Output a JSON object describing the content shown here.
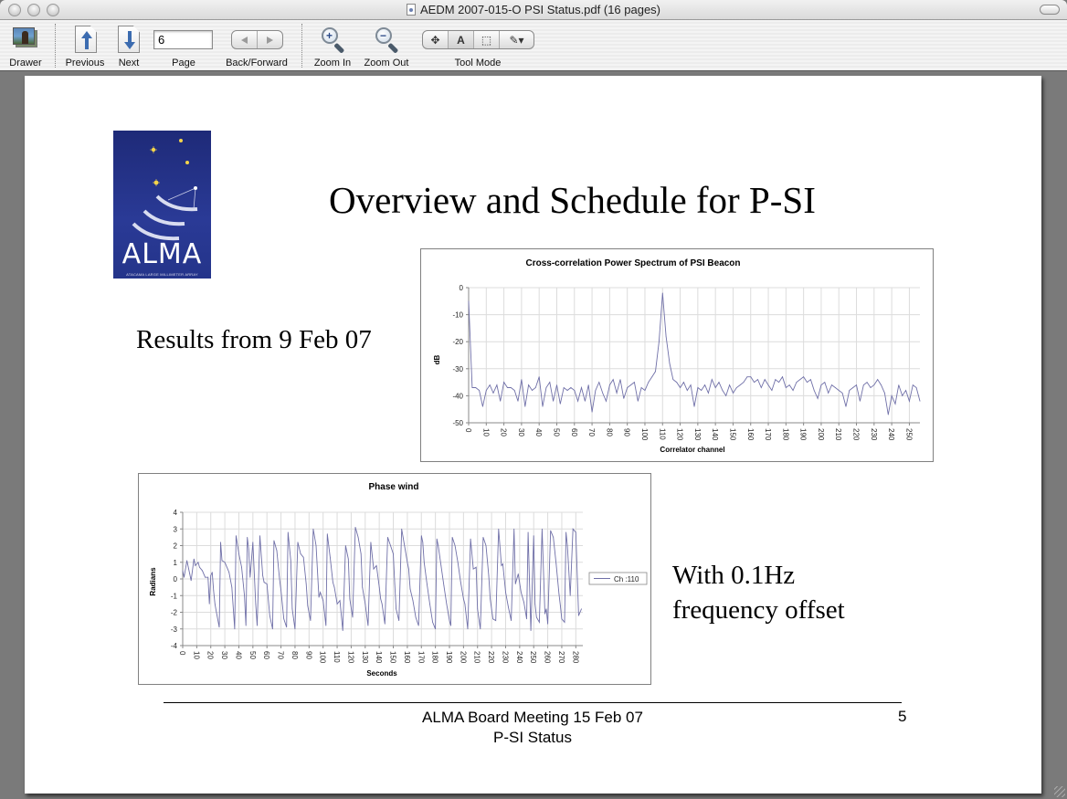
{
  "window": {
    "title": "AEDM 2007-015-O PSI Status.pdf (16 pages)",
    "file_icon": "pdf-document-icon"
  },
  "toolbar": {
    "drawer_label": "Drawer",
    "previous_label": "Previous",
    "next_label": "Next",
    "page_label": "Page",
    "page_value": "6",
    "back_forward_label": "Back/Forward",
    "zoom_in_label": "Zoom In",
    "zoom_out_label": "Zoom Out",
    "tool_mode_label": "Tool Mode",
    "tool_modes": [
      "move",
      "text",
      "select",
      "annotate"
    ],
    "tool_mode_glyphs": [
      "✥",
      "A",
      "⬚",
      "✎▾"
    ],
    "zoom_in_sign": "+",
    "zoom_out_sign": "−"
  },
  "slide": {
    "title": "Overview and Schedule for P-SI",
    "results_text": "Results from 9 Feb 07",
    "offset_line1": "With 0.1Hz",
    "offset_line2": "frequency offset",
    "logo_text": "ALMA",
    "logo_subtext": "ATACAMA LARGE MILLIMETER ARRAY",
    "footer_line1": "ALMA Board Meeting 15 Feb 07",
    "footer_line2": "P-SI Status",
    "page_number": "5"
  },
  "chart_data": [
    {
      "type": "line",
      "title": "Cross-correlation Power Spectrum of PSI Beacon",
      "xlabel": "Correlator channel",
      "ylabel": "dB",
      "xlim": [
        0,
        256
      ],
      "ylim": [
        -50,
        0
      ],
      "xticks": [
        0,
        10,
        20,
        30,
        40,
        50,
        60,
        70,
        80,
        90,
        100,
        110,
        120,
        130,
        140,
        150,
        160,
        170,
        180,
        190,
        200,
        210,
        220,
        230,
        240,
        250
      ],
      "yticks": [
        0,
        -10,
        -20,
        -30,
        -40,
        -50
      ],
      "grid": true,
      "line_color": "#7070a8",
      "x": [
        0,
        2,
        4,
        6,
        8,
        10,
        12,
        14,
        16,
        18,
        20,
        22,
        24,
        26,
        28,
        30,
        32,
        34,
        36,
        38,
        40,
        42,
        44,
        46,
        48,
        50,
        52,
        54,
        56,
        58,
        60,
        62,
        64,
        66,
        68,
        70,
        72,
        74,
        76,
        78,
        80,
        82,
        84,
        86,
        88,
        90,
        92,
        94,
        96,
        98,
        100,
        102,
        104,
        106,
        108,
        110,
        112,
        114,
        116,
        118,
        120,
        122,
        124,
        126,
        128,
        130,
        132,
        134,
        136,
        138,
        140,
        142,
        144,
        146,
        148,
        150,
        152,
        154,
        156,
        158,
        160,
        162,
        164,
        166,
        168,
        170,
        172,
        174,
        176,
        178,
        180,
        182,
        184,
        186,
        188,
        190,
        192,
        194,
        196,
        198,
        200,
        202,
        204,
        206,
        208,
        210,
        212,
        214,
        216,
        218,
        220,
        222,
        224,
        226,
        228,
        230,
        232,
        234,
        236,
        238,
        240,
        242,
        244,
        246,
        248,
        250,
        252,
        254,
        256
      ],
      "values": [
        -5,
        -37,
        -37,
        -38,
        -44,
        -38,
        -36,
        -39,
        -36,
        -42,
        -35,
        -37,
        -37,
        -38,
        -42,
        -34,
        -44,
        -36,
        -38,
        -37,
        -33,
        -44,
        -37,
        -35,
        -42,
        -36,
        -43,
        -37,
        -38,
        -37,
        -38,
        -42,
        -37,
        -42,
        -36,
        -46,
        -38,
        -35,
        -39,
        -42,
        -36,
        -34,
        -39,
        -34,
        -41,
        -37,
        -36,
        -35,
        -42,
        -37,
        -38,
        -35,
        -33,
        -31,
        -20,
        -2,
        -18,
        -28,
        -34,
        -35,
        -37,
        -35,
        -38,
        -36,
        -44,
        -37,
        -38,
        -36,
        -39,
        -34,
        -37,
        -35,
        -38,
        -40,
        -36,
        -39,
        -37,
        -36,
        -35,
        -33,
        -33,
        -35,
        -34,
        -37,
        -34,
        -36,
        -38,
        -34,
        -35,
        -33,
        -37,
        -36,
        -38,
        -35,
        -34,
        -33,
        -35,
        -34,
        -38,
        -41,
        -36,
        -35,
        -39,
        -36,
        -37,
        -38,
        -39,
        -44,
        -38,
        -37,
        -36,
        -42,
        -36,
        -35,
        -37,
        -36,
        -34,
        -36,
        -39,
        -47,
        -40,
        -43,
        -36,
        -40,
        -38,
        -42,
        -36,
        -37,
        -42
      ]
    },
    {
      "type": "line",
      "title": "Phase wind",
      "xlabel": "Seconds",
      "ylabel": "Radians",
      "xlim": [
        0,
        285
      ],
      "ylim": [
        -4,
        4
      ],
      "xticks": [
        0,
        10,
        20,
        30,
        40,
        50,
        60,
        70,
        80,
        90,
        100,
        110,
        120,
        130,
        140,
        150,
        160,
        170,
        180,
        190,
        200,
        210,
        220,
        230,
        240,
        250,
        260,
        270,
        280
      ],
      "yticks": [
        4,
        3,
        2,
        1,
        0,
        -1,
        -2,
        -3,
        -4
      ],
      "grid": true,
      "legend": [
        "Ch :110"
      ],
      "legend_position": "right",
      "line_color": "#7070a8",
      "x": [
        0,
        1,
        3,
        5,
        6,
        8,
        9,
        11,
        12,
        14,
        16,
        18,
        19,
        20,
        21,
        22,
        23,
        24,
        26,
        27,
        28,
        30,
        32,
        33,
        35,
        37,
        38,
        40,
        42,
        44,
        45,
        46,
        47,
        48,
        50,
        52,
        53,
        55,
        57,
        58,
        60,
        62,
        64,
        65,
        67,
        69,
        70,
        72,
        74,
        75,
        77,
        78,
        80,
        82,
        84,
        86,
        88,
        89,
        91,
        93,
        95,
        97,
        98,
        100,
        102,
        103,
        105,
        107,
        108,
        110,
        112,
        114,
        116,
        118,
        119,
        121,
        123,
        125,
        127,
        128,
        130,
        132,
        134,
        136,
        138,
        140,
        141,
        142,
        144,
        146,
        148,
        150,
        151,
        152,
        154,
        156,
        158,
        160,
        161,
        162,
        164,
        166,
        168,
        170,
        171,
        172,
        174,
        176,
        178,
        180,
        181,
        182,
        184,
        186,
        188,
        190,
        191,
        192,
        194,
        196,
        198,
        200,
        201,
        203,
        205,
        207,
        209,
        210,
        212,
        214,
        216,
        218,
        219,
        221,
        223,
        225,
        227,
        228,
        230,
        232,
        234,
        236,
        237,
        239,
        241,
        243,
        245,
        246,
        248,
        250,
        251,
        252,
        254,
        256,
        258,
        259,
        260,
        262,
        264,
        266,
        268,
        269,
        270,
        272,
        273,
        274,
        276,
        278,
        280,
        282,
        284
      ],
      "values": [
        0.5,
        0.1,
        1.1,
        0.3,
        -0.1,
        1.2,
        0.8,
        1.0,
        0.7,
        0.5,
        0.1,
        0.1,
        -1.5,
        0.2,
        0.4,
        -0.7,
        -1.5,
        -2.0,
        -2.9,
        2.2,
        1.1,
        1.0,
        0.6,
        0.4,
        -0.5,
        -3.0,
        2.6,
        1.5,
        0.7,
        -1.0,
        -2.8,
        2.5,
        1.8,
        0.1,
        2.2,
        -1.5,
        -2.8,
        2.6,
        0.2,
        -0.2,
        -0.3,
        -2.2,
        -3.0,
        2.3,
        1.7,
        0.0,
        -0.7,
        -2.4,
        -2.9,
        2.8,
        1.1,
        -1.8,
        -3.0,
        2.2,
        1.5,
        1.3,
        -0.3,
        -1.6,
        -2.5,
        3.0,
        2.0,
        -1.1,
        -0.8,
        -1.3,
        -2.8,
        2.7,
        1.3,
        -0.2,
        -0.5,
        -1.5,
        -1.3,
        -3.1,
        2.0,
        1.2,
        -1.2,
        -2.3,
        3.1,
        2.5,
        1.5,
        -0.5,
        -1.5,
        -2.8,
        2.2,
        0.6,
        0.8,
        -0.5,
        -1.2,
        -1.5,
        -2.7,
        2.5,
        2.0,
        1.5,
        -0.3,
        -1.8,
        -2.5,
        3.0,
        2.0,
        1.0,
        0.6,
        -0.6,
        -1.3,
        -2.3,
        -2.8,
        2.6,
        2.2,
        1.0,
        -0.3,
        -1.5,
        -2.6,
        -3.0,
        2.4,
        2.0,
        0.8,
        -0.4,
        -1.5,
        -2.5,
        -2.8,
        2.5,
        2.0,
        1.0,
        -0.2,
        -1.2,
        -1.5,
        -3.0,
        2.4,
        0.6,
        0.7,
        -1.8,
        -3.0,
        2.5,
        2.0,
        0.2,
        -1.2,
        -2.4,
        -2.5,
        3.0,
        0.8,
        0.9,
        -0.8,
        -1.7,
        -2.5,
        3.0,
        -0.3,
        0.3,
        -0.8,
        -1.4,
        -2.4,
        2.8,
        -3.1,
        2.6,
        -1.5,
        -2.3,
        -2.6,
        3.0,
        -2.1,
        -1.8,
        -2.7,
        2.9,
        2.5,
        0.9,
        -0.9,
        -1.6,
        -2.4,
        -2.6,
        2.8,
        2.0,
        -1.0,
        3.0,
        2.8,
        -2.2,
        -1.8,
        -1.2,
        -1.7,
        -1.1
      ]
    }
  ]
}
